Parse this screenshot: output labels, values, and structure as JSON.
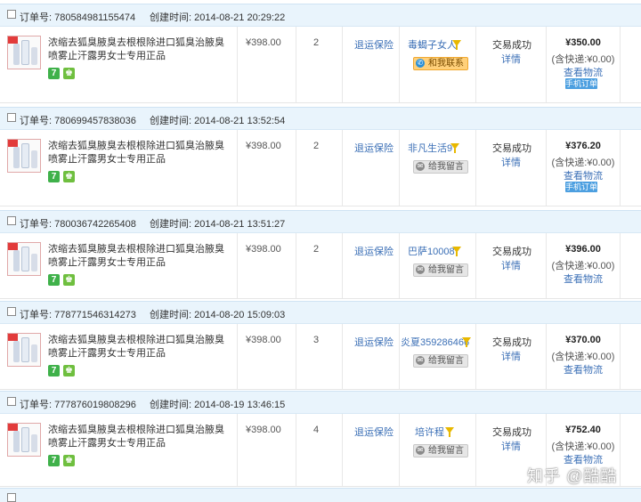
{
  "labels": {
    "order_prefix": "订单号: ",
    "time_prefix": "创建时间: "
  },
  "orders": [
    {
      "id": "780584981155474",
      "created": "2014-08-21 20:29:22",
      "title": "浓缩去狐臭腋臭去根根除进口狐臭治腋臭喷雾止汗露男女士专用正品",
      "price": "¥398.00",
      "qty": "2",
      "service": "退运保险",
      "seller": "毒蝎子女人",
      "contact": "和我联系",
      "contact_style": "orange",
      "status": "交易成功",
      "detail": "详情",
      "total": "¥350.00",
      "shipping": "(含快递:¥0.00)",
      "logistics": "查看物流",
      "mobile_order": "手机订单"
    },
    {
      "id": "780699457838036",
      "created": "2014-08-21 13:52:54",
      "title": "浓缩去狐臭腋臭去根根除进口狐臭治腋臭喷雾止汗露男女士专用正品",
      "price": "¥398.00",
      "qty": "2",
      "service": "退运保险",
      "seller": "非凡生活9",
      "contact": "给我留言",
      "contact_style": "gray",
      "status": "交易成功",
      "detail": "详情",
      "total": "¥376.20",
      "shipping": "(含快递:¥0.00)",
      "logistics": "查看物流",
      "mobile_order": "手机订单"
    },
    {
      "id": "780036742265408",
      "created": "2014-08-21 13:51:27",
      "title": "浓缩去狐臭腋臭去根根除进口狐臭治腋臭喷雾止汗露男女士专用正品",
      "price": "¥398.00",
      "qty": "2",
      "service": "退运保险",
      "seller": "巴萨10008",
      "contact": "给我留言",
      "contact_style": "gray",
      "status": "交易成功",
      "detail": "详情",
      "total": "¥396.00",
      "shipping": "(含快递:¥0.00)",
      "logistics": "查看物流",
      "mobile_order": ""
    },
    {
      "id": "778771546314273",
      "created": "2014-08-20 15:09:03",
      "title": "浓缩去狐臭腋臭去根根除进口狐臭治腋臭喷雾止汗露男女士专用正品",
      "price": "¥398.00",
      "qty": "3",
      "service": "退运保险",
      "seller": "炎夏359286466",
      "contact": "给我留言",
      "contact_style": "gray",
      "status": "交易成功",
      "detail": "详情",
      "total": "¥370.00",
      "shipping": "(含快递:¥0.00)",
      "logistics": "查看物流",
      "mobile_order": ""
    },
    {
      "id": "777876019808296",
      "created": "2014-08-19 13:46:15",
      "title": "浓缩去狐臭腋臭去根根除进口狐臭治腋臭喷雾止汗露男女士专用正品",
      "price": "¥398.00",
      "qty": "4",
      "service": "退运保险",
      "seller": "培许程",
      "contact": "给我留言",
      "contact_style": "gray",
      "status": "交易成功",
      "detail": "详情",
      "total": "¥752.40",
      "shipping": "(含快递:¥0.00)",
      "logistics": "查看物流",
      "mobile_order": ""
    }
  ],
  "badges": {
    "seven_days": "7",
    "guarantee": "♚"
  },
  "watermark": "知乎 @酷酷",
  "colors": {
    "header_bg": "#e9f4fc",
    "link": "#3b6fb6",
    "mobile_btn": "#4c9fe0"
  }
}
